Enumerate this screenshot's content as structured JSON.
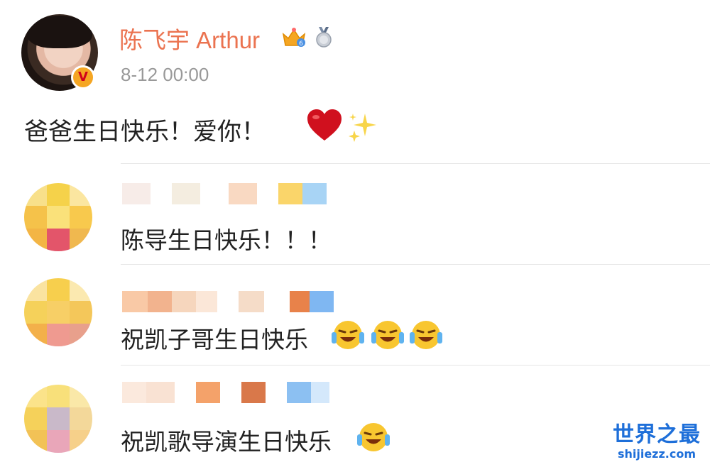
{
  "post": {
    "author": "陈飞宇 Arthur",
    "time": "8-12 00:00",
    "text": "爸爸生日快乐！爱你！",
    "icons": [
      "crown-level-icon",
      "medal-icon",
      "heart-icon",
      "sparkles-icon",
      "verified-v-icon"
    ],
    "verified_badge": "V"
  },
  "comments": [
    {
      "text": "陈导生日快乐！！！"
    },
    {
      "text": "祝凯子哥生日快乐"
    },
    {
      "text": "祝凯歌导演生日快乐"
    }
  ],
  "watermark": {
    "title": "世界之最",
    "url": "shijiezz.com"
  },
  "colors": {
    "author": "#eb7350",
    "timestamp": "#999999",
    "watermark": "#1e6fd9"
  }
}
